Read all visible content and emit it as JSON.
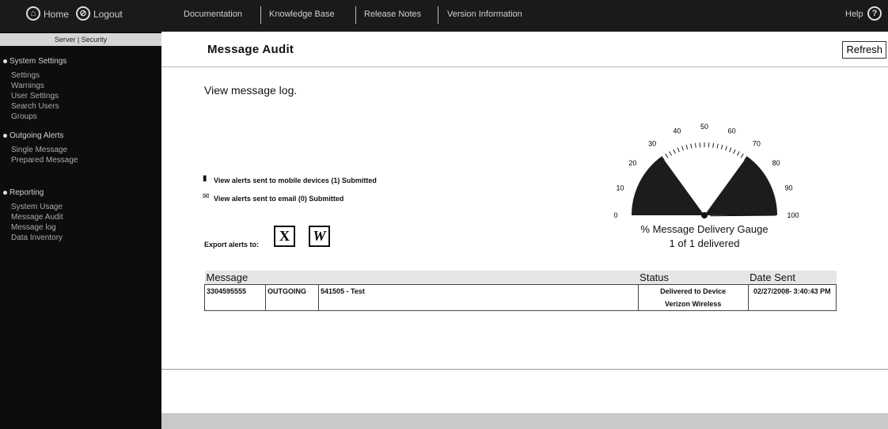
{
  "topbar": {
    "home_label": "Home",
    "logout_label": "Logout",
    "links": [
      "Documentation",
      "Knowledge Base",
      "Release Notes",
      "Version Information"
    ],
    "help_label": "Help",
    "help_icon": "?"
  },
  "sidebar": {
    "tabs": "Server | Security",
    "sections": [
      {
        "title": "System Settings",
        "items": [
          "Settings",
          "Warnings",
          "User Settings",
          "Search Users",
          "Groups"
        ]
      },
      {
        "title": "Outgoing Alerts",
        "items": [
          "Single Message",
          "Prepared Message"
        ]
      },
      {
        "title": "Reporting",
        "items": [
          "System Usage",
          "Message Audit",
          "Message log",
          "Data Inventory"
        ]
      }
    ]
  },
  "page": {
    "title": "Message Audit",
    "refresh_label": "Refresh",
    "description": "View message log.",
    "mobile_alerts": "View alerts sent to mobile devices (1) Submitted",
    "email_alerts": "View alerts sent to email (0) Submitted",
    "export_label": "Export alerts to:",
    "export_excel": "X",
    "export_word": "W"
  },
  "gauge": {
    "title": "% Message Delivery Gauge",
    "subtitle": "1 of 1 delivered",
    "value_percent": 100,
    "tick_labels": [
      "0",
      "10",
      "20",
      "30",
      "40",
      "50",
      "60",
      "70",
      "80",
      "90",
      "100"
    ]
  },
  "table": {
    "headers": [
      "Message",
      "Status",
      "Date Sent"
    ],
    "rows": [
      {
        "number": "3304595555",
        "direction": "OUTGOING",
        "message": "541505 - Test",
        "status_line1": "Delivered to Device",
        "status_line2": "Verizon Wireless",
        "date_sent": "02/27/2008- 3:40:43 PM"
      }
    ]
  },
  "colors": {
    "topbar": "#1a1a1a",
    "sidebar": "#0d0d0d",
    "gauge_fill": "#1c1c1c"
  }
}
